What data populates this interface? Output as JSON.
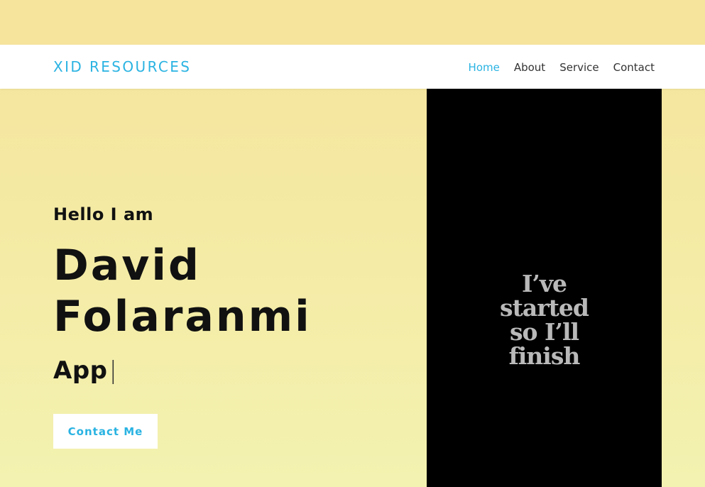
{
  "header": {
    "brand": "XID RESOURCES",
    "nav": [
      {
        "label": "Home",
        "active": true
      },
      {
        "label": "About",
        "active": false
      },
      {
        "label": "Service",
        "active": false
      },
      {
        "label": "Contact",
        "active": false
      }
    ]
  },
  "hero": {
    "greeting": "Hello I am",
    "name_line1": "David",
    "name_line2": "Folaranmi",
    "role": "App",
    "cursor": "|",
    "cta_label": "Contact Me"
  },
  "image": {
    "lines": [
      "I’ve",
      "started",
      "so I’ll",
      "finish"
    ]
  },
  "colors": {
    "accent": "#2ab3e2",
    "background_top": "#f6e39c",
    "background_bottom": "#f3f2b0",
    "text": "#111111",
    "image_background": "#000000"
  }
}
